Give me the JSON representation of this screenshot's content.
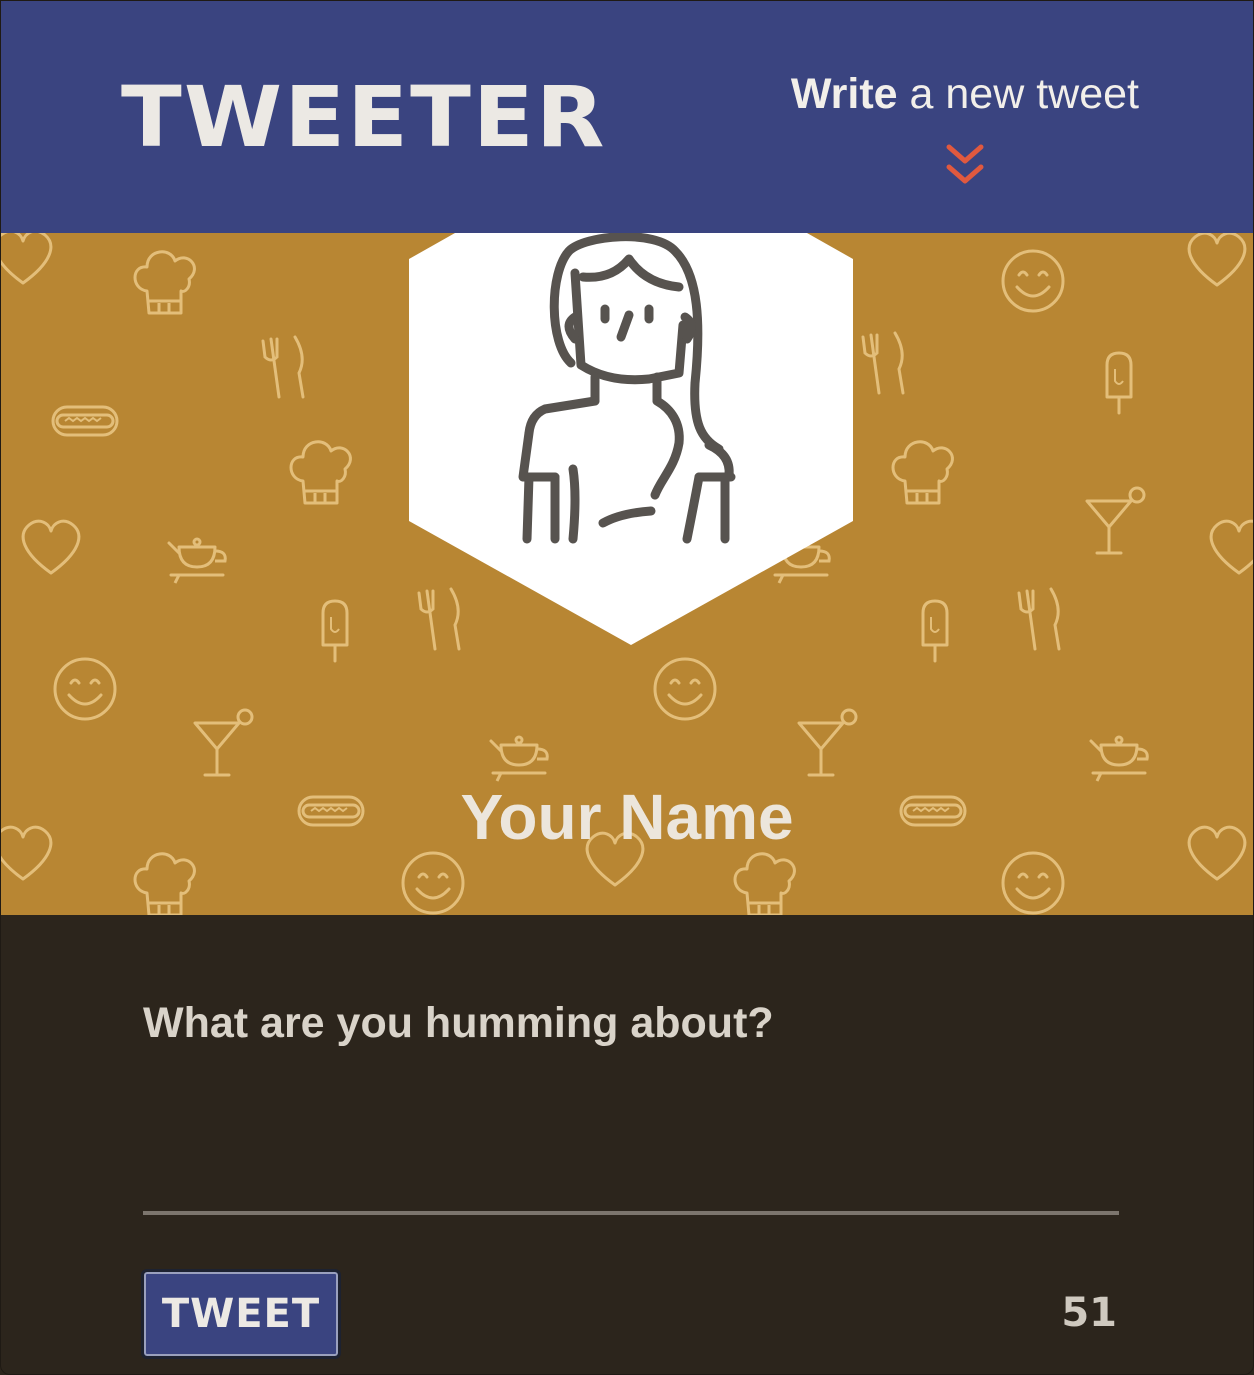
{
  "nav": {
    "logo": "TWEETER",
    "compose_bold": "Write",
    "compose_rest": " a new tweet",
    "chevron_icon": "double-chevron-down-icon"
  },
  "profile": {
    "name": "Your Name",
    "avatar_icon": "woman-avatar-icon",
    "pattern_icons": [
      "chef-hat-icon",
      "cutlery-icon",
      "hot-dog-icon",
      "heart-icon",
      "teapot-icon",
      "popsicle-icon",
      "smiley-icon",
      "cocktail-icon"
    ]
  },
  "composer": {
    "placeholder": "What are you humming about?",
    "button_label": "TWEET",
    "char_count": "51"
  },
  "colors": {
    "nav_bg": "#3a4480",
    "banner_bg": "#b88633",
    "composer_bg": "#2c251c",
    "accent": "#e0593f",
    "pattern_stroke": "#e3be7a"
  }
}
